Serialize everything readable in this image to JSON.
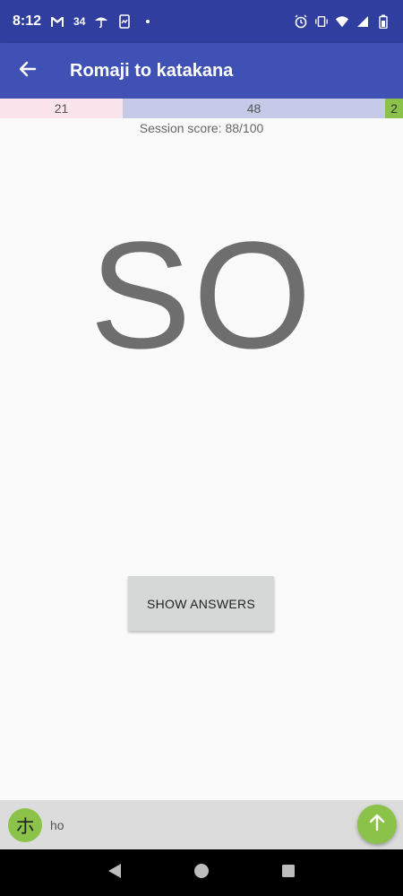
{
  "status_bar": {
    "time": "8:12",
    "network_label": "34",
    "icons": [
      "gmail-icon",
      "umbrella-icon",
      "screenshot-icon",
      "alarm-icon",
      "vibrate-icon",
      "wifi-icon",
      "signal-icon",
      "battery-icon"
    ]
  },
  "app_bar": {
    "title": "Romaji to katakana",
    "back_icon": "arrow-back-icon"
  },
  "score_bar": {
    "wrong": "21",
    "middle": "48",
    "right": "2"
  },
  "session_score": "Session score: 88/100",
  "prompt": "SO",
  "show_answers_label": "SHOW ANSWERS",
  "previous": {
    "kana": "ホ",
    "romaji": "ho"
  },
  "fab_icon": "arrow-up-icon",
  "nav": {
    "back_icon": "nav-back-icon",
    "home_icon": "nav-home-icon",
    "recents_icon": "nav-recents-icon"
  },
  "colors": {
    "status_bar": "#303f9f",
    "app_bar": "#3f51b5",
    "accent_green": "#8bc34a",
    "wrong_segment": "#fce4ec",
    "middle_segment": "#c5cae9"
  }
}
